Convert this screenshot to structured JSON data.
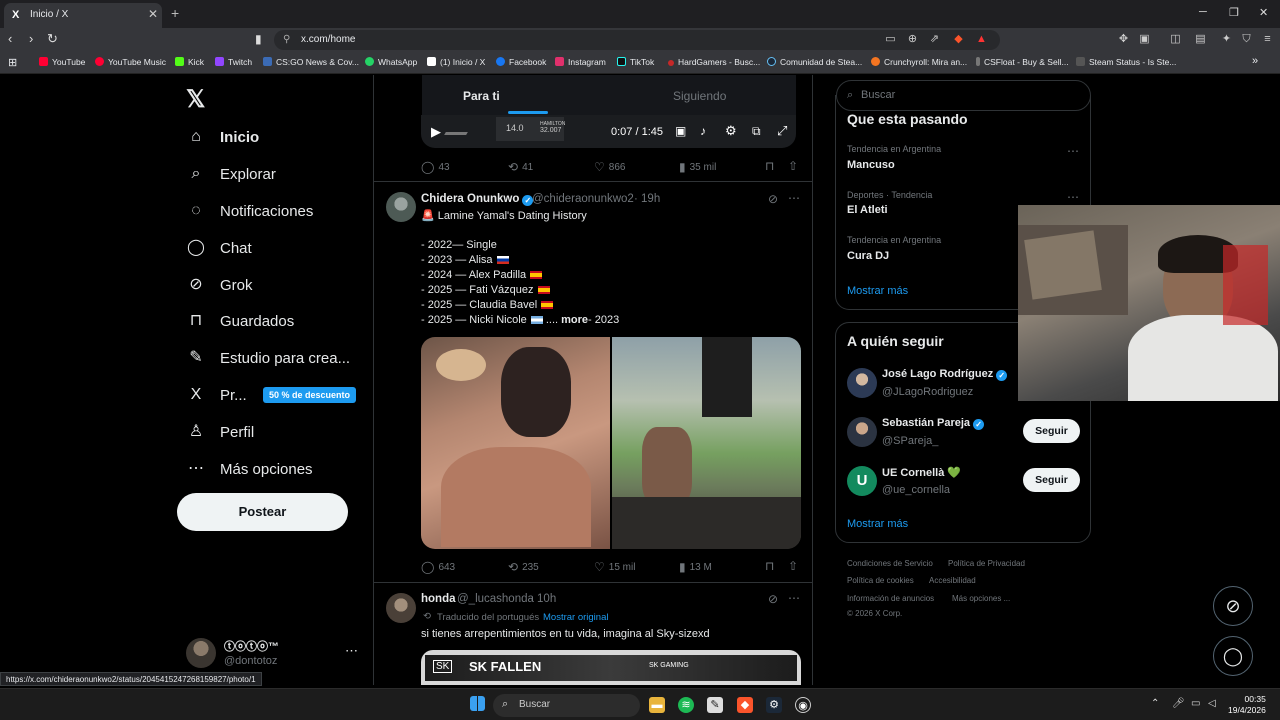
{
  "browser": {
    "tab_title": "Inicio / X",
    "tab_favicon": "X",
    "url": "x.com/home",
    "bookmarks": [
      {
        "label": "YouTube",
        "color": "#ff0033"
      },
      {
        "label": "YouTube Music",
        "color": "#ff0033"
      },
      {
        "label": "Kick",
        "color": "#53fc18"
      },
      {
        "label": "Twitch",
        "color": "#9146ff"
      },
      {
        "label": "CS:GO News & Cov...",
        "color": "#3b6bb5"
      },
      {
        "label": "WhatsApp",
        "color": "#25d366"
      },
      {
        "label": "(1) Inicio / X",
        "color": "#ffffff"
      },
      {
        "label": "Facebook",
        "color": "#1877f2"
      },
      {
        "label": "Instagram",
        "color": "#e1306c"
      },
      {
        "label": "TikTok",
        "color": "#111111"
      },
      {
        "label": "HardGamers - Busc...",
        "color": "#c62828"
      },
      {
        "label": "Comunidad de Stea...",
        "color": "#1b2838"
      },
      {
        "label": "Crunchyroll: Mira an...",
        "color": "#f47521"
      },
      {
        "label": "CSFloat - Buy & Sell...",
        "color": "#777777"
      },
      {
        "label": "Steam Status - Is Ste...",
        "color": "#555555"
      }
    ],
    "status_url": "https://x.com/chideraonunkwo2/status/2045415247268159827/photo/1"
  },
  "sidebar": {
    "items": [
      {
        "label": "Inicio",
        "icon": "home-icon",
        "glyph": "⌂"
      },
      {
        "label": "Explorar",
        "icon": "search-icon",
        "glyph": "⌕"
      },
      {
        "label": "Notificaciones",
        "icon": "bell-icon",
        "glyph": "◌"
      },
      {
        "label": "Chat",
        "icon": "chat-icon",
        "glyph": "◯"
      },
      {
        "label": "Grok",
        "icon": "grok-icon",
        "glyph": "⊘"
      },
      {
        "label": "Guardados",
        "icon": "bookmark-icon",
        "glyph": "⊓"
      },
      {
        "label": "Estudio para crea...",
        "icon": "creator-studio-icon",
        "glyph": "✎"
      },
      {
        "label": "Pr...",
        "icon": "x-premium-icon",
        "glyph": "X"
      },
      {
        "label": "Perfil",
        "icon": "profile-icon",
        "glyph": "♙"
      },
      {
        "label": "Más opciones",
        "icon": "more-options-icon",
        "glyph": "⋯"
      }
    ],
    "promo_badge": "50 % de descuento",
    "post_button": "Postear",
    "account": {
      "name": "ⓣⓞⓣⓞ™",
      "handle": "@dontotoz"
    }
  },
  "feed": {
    "tabs": [
      "Para ti",
      "Siguiendo"
    ],
    "video": {
      "time": "0:07 / 1:45",
      "thumb_left": "14.0",
      "thumb_right_top": "HAMILTON",
      "thumb_right": "32.007"
    },
    "prev_actions": {
      "replies": "43",
      "reposts": "41",
      "likes": "866",
      "views": "35 mil"
    },
    "tweet1": {
      "name": "Chidera Onunkwo",
      "handle": "@chideraonunkwo2",
      "time": "· 19h",
      "headline": "🚨 Lamine Yamal's Dating History",
      "lines": [
        {
          "text": "- 2022— Single",
          "flag": ""
        },
        {
          "text": "- 2023 — Alisa",
          "flag": "ru"
        },
        {
          "text": "- 2024 — Alex Padilla",
          "flag": "es"
        },
        {
          "text": "- 2025 — Fati Vázquez",
          "flag": "es"
        },
        {
          "text": "- 2025 — Claudia Bavel",
          "flag": "es"
        },
        {
          "text": "- 2025 — Nicki Nicole",
          "flag": "ar"
        }
      ],
      "more_prefix": "....",
      "more": "more",
      "more_suffix": "- 2023",
      "actions": {
        "replies": "643",
        "reposts": "235",
        "likes": "15 mil",
        "views": "13 M"
      }
    },
    "tweet2": {
      "name": "honda",
      "handle": "@_lucashonda",
      "time": "· 10h",
      "translated": "Traducido del portugués",
      "show_original": "Mostrar original",
      "text": "si tienes arrepentimientos en tu vida, imagina al Sky-sizexd",
      "media_left": "SK FALLEN",
      "media_right": "SK GAMING"
    }
  },
  "right": {
    "search_placeholder": "Buscar",
    "trends_title": "Que esta pasando",
    "trends": [
      {
        "context": "Tendencia en Argentina",
        "name": "Mancuso"
      },
      {
        "context": "Deportes · Tendencia",
        "name": "El Atleti"
      },
      {
        "context": "Tendencia en Argentina",
        "name": "Cura DJ"
      }
    ],
    "trends_more": "Mostrar más",
    "who_title": "A quién seguir",
    "who": [
      {
        "name": "José Lago Rodríguez",
        "handle": "@JLagoRodriguez",
        "verified": true,
        "follow": ""
      },
      {
        "name": "Sebastián Pareja",
        "handle": "@SPareja_",
        "verified": true,
        "follow": "Seguir"
      },
      {
        "name": "UE Cornellà 💚",
        "handle": "@ue_cornella",
        "verified": false,
        "follow": "Seguir"
      }
    ],
    "who_more": "Mostrar más",
    "footer": [
      "Condiciones de Servicio",
      "Política de Privacidad",
      "Política de cookies",
      "Accesibilidad",
      "Información de anuncios",
      "Más opciones ...",
      "© 2026 X Corp."
    ]
  },
  "taskbar": {
    "search": "Buscar",
    "time": "00:35",
    "date": "19/4/2026"
  },
  "colors": {
    "accent": "#1d9bf0",
    "background": "#000000",
    "border": "#2f3336",
    "muted": "#71767b"
  }
}
